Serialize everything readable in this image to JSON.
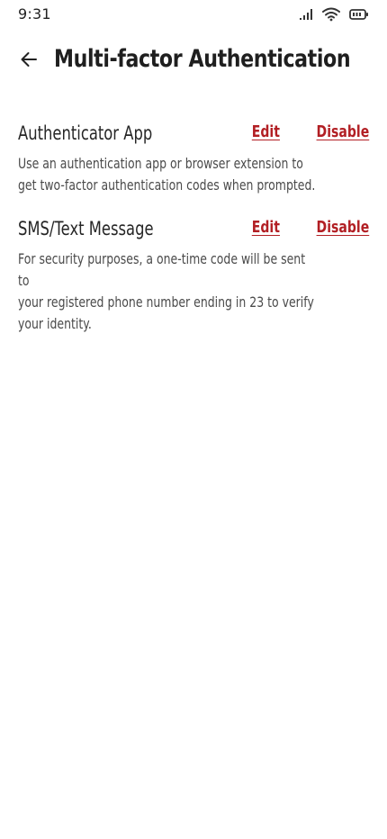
{
  "status_bar": {
    "time": "9:31",
    "icons": [
      "signal-icon",
      "wifi-icon",
      "battery-icon"
    ]
  },
  "header": {
    "back_icon": "arrow-left-icon",
    "title": "Multi-factor Authentication"
  },
  "methods": [
    {
      "title": "Authenticator App",
      "description_lines": [
        "Use an authentication app or browser extension to",
        "get two-factor authentication codes when prompted."
      ],
      "edit_label": "Edit",
      "disable_label": "Disable"
    },
    {
      "title": "SMS/Text Message",
      "description_lines": [
        "For security purposes, a one-time code will be sent to",
        "your registered phone number ending in 23 to verify",
        "your identity."
      ],
      "edit_label": "Edit",
      "disable_label": "Disable"
    }
  ],
  "colors": {
    "accent": "#b21f24",
    "text": "#2b2b2b",
    "muted": "#4a4a4a",
    "background": "#ffffff"
  }
}
